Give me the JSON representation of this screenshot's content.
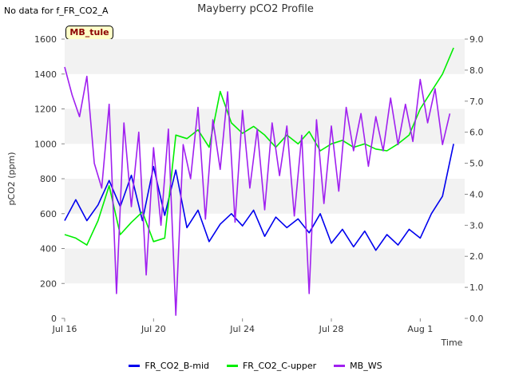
{
  "note": "No data for f_FR_CO2_A",
  "site_label": "MB_tule",
  "chart_data": {
    "type": "line",
    "title": "Mayberry pCO2 Profile",
    "xlabel": "Time",
    "ylabel": "pCO2 (ppm)",
    "ylim": [
      0,
      1600
    ],
    "y2lim": [
      0.0,
      9.0
    ],
    "xlim": [
      "2019-07-16",
      "2019-08-03"
    ],
    "x_ticks": [
      "Jul 16",
      "Jul 20",
      "Jul 24",
      "Jul 28",
      "Aug 1"
    ],
    "y_ticks": [
      "0",
      "200",
      "400",
      "600",
      "800",
      "1000",
      "1200",
      "1400",
      "1600"
    ],
    "y2_ticks": [
      "0.0",
      "1.0",
      "2.0",
      "3.0",
      "4.0",
      "5.0",
      "6.0",
      "7.0",
      "8.0",
      "9.0"
    ],
    "grid": "horizontal bands",
    "legend_position": "bottom",
    "series": [
      {
        "name": "FR_CO2_B-mid",
        "color": "#0000ee",
        "axis": "left",
        "x": [
          "2019-07-16",
          "2019-07-16T12:00",
          "2019-07-17",
          "2019-07-17T12:00",
          "2019-07-18",
          "2019-07-18T12:00",
          "2019-07-19",
          "2019-07-19T12:00",
          "2019-07-20",
          "2019-07-20T12:00",
          "2019-07-21",
          "2019-07-21T12:00",
          "2019-07-22",
          "2019-07-22T12:00",
          "2019-07-23",
          "2019-07-23T12:00",
          "2019-07-24",
          "2019-07-24T12:00",
          "2019-07-25",
          "2019-07-25T12:00",
          "2019-07-26",
          "2019-07-26T12:00",
          "2019-07-27",
          "2019-07-27T12:00",
          "2019-07-28",
          "2019-07-28T12:00",
          "2019-07-29",
          "2019-07-29T12:00",
          "2019-07-30",
          "2019-07-30T12:00",
          "2019-07-31",
          "2019-07-31T12:00",
          "2019-08-01",
          "2019-08-01T12:00",
          "2019-08-02",
          "2019-08-02T12:00"
        ],
        "y": [
          560,
          680,
          560,
          650,
          790,
          640,
          820,
          560,
          870,
          590,
          850,
          520,
          620,
          440,
          540,
          600,
          530,
          620,
          470,
          580,
          520,
          570,
          490,
          600,
          430,
          510,
          410,
          500,
          390,
          480,
          420,
          510,
          460,
          600,
          700,
          1000
        ]
      },
      {
        "name": "FR_CO2_C-upper",
        "color": "#00ee00",
        "axis": "left",
        "x": [
          "2019-07-16",
          "2019-07-16T12:00",
          "2019-07-17",
          "2019-07-17T12:00",
          "2019-07-18",
          "2019-07-18T12:00",
          "2019-07-19",
          "2019-07-19T12:00",
          "2019-07-20",
          "2019-07-20T12:00",
          "2019-07-21",
          "2019-07-21T12:00",
          "2019-07-22",
          "2019-07-22T12:00",
          "2019-07-23",
          "2019-07-23T12:00",
          "2019-07-24",
          "2019-07-24T12:00",
          "2019-07-25",
          "2019-07-25T12:00",
          "2019-07-26",
          "2019-07-26T12:00",
          "2019-07-27",
          "2019-07-27T12:00",
          "2019-07-28",
          "2019-07-28T12:00",
          "2019-07-29",
          "2019-07-29T12:00",
          "2019-07-30",
          "2019-07-30T12:00",
          "2019-07-31",
          "2019-07-31T12:00",
          "2019-08-01",
          "2019-08-01T12:00",
          "2019-08-02",
          "2019-08-02T12:00"
        ],
        "y": [
          480,
          460,
          420,
          560,
          760,
          480,
          550,
          610,
          440,
          460,
          1050,
          1030,
          1080,
          980,
          1300,
          1120,
          1060,
          1100,
          1050,
          980,
          1050,
          1000,
          1070,
          960,
          1000,
          1020,
          980,
          1000,
          970,
          960,
          1000,
          1050,
          1200,
          1300,
          1400,
          1550
        ]
      },
      {
        "name": "MB_WS",
        "color": "#a020f0",
        "axis": "right",
        "x": [
          "2019-07-16",
          "2019-07-16T08:00",
          "2019-07-16T16:00",
          "2019-07-17",
          "2019-07-17T08:00",
          "2019-07-17T16:00",
          "2019-07-18",
          "2019-07-18T08:00",
          "2019-07-18T16:00",
          "2019-07-19",
          "2019-07-19T08:00",
          "2019-07-19T16:00",
          "2019-07-20",
          "2019-07-20T08:00",
          "2019-07-20T16:00",
          "2019-07-21",
          "2019-07-21T08:00",
          "2019-07-21T16:00",
          "2019-07-22",
          "2019-07-22T08:00",
          "2019-07-22T16:00",
          "2019-07-23",
          "2019-07-23T08:00",
          "2019-07-23T16:00",
          "2019-07-24",
          "2019-07-24T08:00",
          "2019-07-24T16:00",
          "2019-07-25",
          "2019-07-25T08:00",
          "2019-07-25T16:00",
          "2019-07-26",
          "2019-07-26T08:00",
          "2019-07-26T16:00",
          "2019-07-27",
          "2019-07-27T08:00",
          "2019-07-27T16:00",
          "2019-07-28",
          "2019-07-28T08:00",
          "2019-07-28T16:00",
          "2019-07-29",
          "2019-07-29T08:00",
          "2019-07-29T16:00",
          "2019-07-30",
          "2019-07-30T08:00",
          "2019-07-30T16:00",
          "2019-07-31",
          "2019-07-31T08:00",
          "2019-07-31T16:00",
          "2019-08-01",
          "2019-08-01T08:00",
          "2019-08-01T16:00",
          "2019-08-02",
          "2019-08-02T08:00"
        ],
        "y": [
          8.1,
          7.2,
          6.5,
          7.8,
          5.0,
          4.2,
          6.9,
          0.8,
          6.3,
          3.6,
          6.0,
          1.4,
          5.5,
          3.0,
          6.1,
          0.1,
          5.6,
          4.5,
          6.8,
          3.2,
          6.4,
          4.8,
          7.3,
          3.1,
          6.7,
          4.2,
          6.1,
          3.5,
          6.3,
          4.6,
          6.2,
          3.3,
          5.9,
          0.8,
          6.4,
          3.7,
          6.2,
          4.1,
          6.8,
          5.4,
          6.6,
          4.9,
          6.5,
          5.4,
          7.1,
          5.6,
          6.9,
          5.7,
          7.7,
          6.3,
          7.4,
          5.6,
          6.6
        ]
      }
    ]
  }
}
